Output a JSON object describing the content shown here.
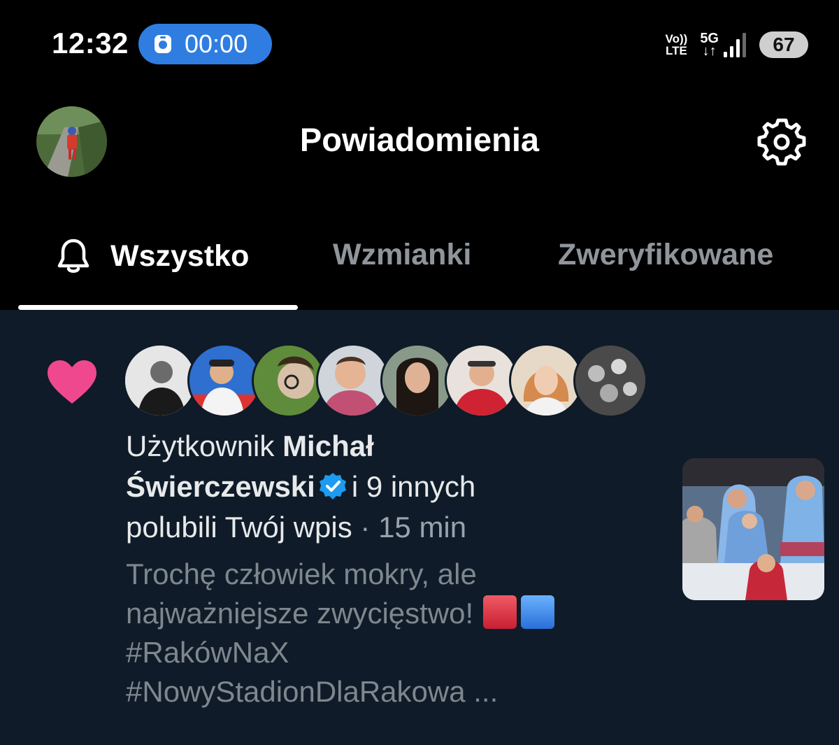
{
  "status_bar": {
    "time": "12:32",
    "timer": "00:00",
    "volte_top": "Vo))",
    "volte_bottom": "LTE",
    "network": "5G",
    "network_arrows": "↓↑",
    "battery": "67"
  },
  "header": {
    "title": "Powiadomienia",
    "avatar_icon": "profile-avatar",
    "settings_icon": "gear-icon"
  },
  "tabs": [
    {
      "label": "Wszystko",
      "icon": "bell-icon",
      "active": true
    },
    {
      "label": "Wzmianki",
      "active": false
    },
    {
      "label": "Zweryfikowane",
      "active": false
    }
  ],
  "notification": {
    "type_icon": "heart-icon",
    "prefix": "Użytkownik",
    "name_part1": "Michał",
    "name_part2": "Świerczewski",
    "others": "i 9 innych",
    "action": "polubili Twój wpis",
    "separator": "·",
    "time": "15 min",
    "snippet_line1": "Trochę człowiek mokry, ale",
    "snippet_line2": "najważniejsze zwycięstwo!",
    "hashtag1": "#RakówNaX",
    "hashtag2": "#NowyStadionDlaRakowa ...",
    "liker_count_avatars": 8
  },
  "colors": {
    "background_top": "#000000",
    "feed_background": "#0f1b28",
    "accent_blue": "#2f7de1",
    "heart_pink": "#f0488f",
    "verified_blue": "#1d9bf0",
    "inactive_tab": "#8f959b"
  }
}
